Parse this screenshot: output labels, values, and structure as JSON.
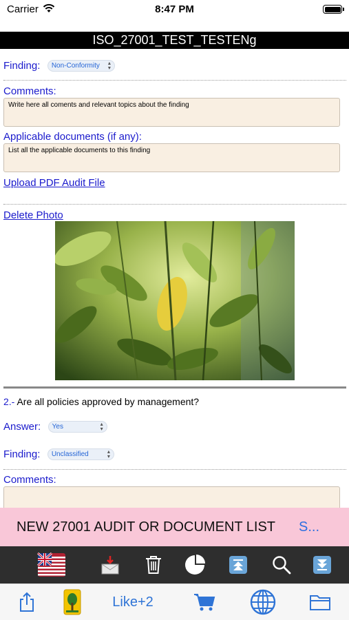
{
  "status": {
    "carrier": "Carrier",
    "time": "8:47 PM"
  },
  "header": {
    "title": "ISO_27001_TEST_TESTENg"
  },
  "finding1": {
    "finding_label": "Finding:",
    "finding_value": "Non-Conformity",
    "comments_label": "Comments:",
    "comments_text": "Write here all coments and relevant topics about the finding",
    "docs_label": "Applicable documents (if any):",
    "docs_text": "List all the applicable documents to this finding",
    "upload_link": "Upload PDF Audit File",
    "delete_link": "Delete Photo"
  },
  "question2": {
    "number": "2.-",
    "text": "Are all policies approved by management?",
    "answer_label": "Answer:",
    "answer_value": "Yes",
    "finding_label": "Finding:",
    "finding_value": "Unclassified",
    "comments_label": "Comments:"
  },
  "banner": {
    "text": "NEW 27001 AUDIT OR DOCUMENT LIST",
    "more": "S..."
  },
  "toolbar": {
    "icons": [
      "uk-flag-icon",
      "mail-inbox-icon",
      "trash-icon",
      "pie-chart-icon",
      "scroll-top-icon",
      "search-icon",
      "scroll-bottom-icon"
    ]
  },
  "tabbar": {
    "like_label": "Like+2"
  },
  "colors": {
    "accent": "#2f74d6",
    "link": "#1a1acc",
    "banner": "#f9c7d8",
    "toolbar": "#2e2e2e"
  }
}
